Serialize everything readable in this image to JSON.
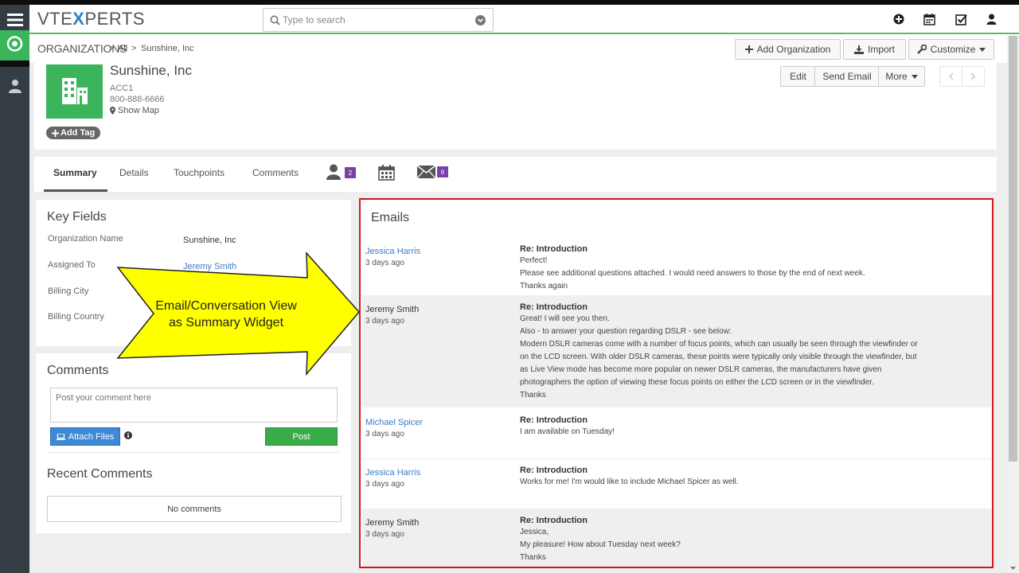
{
  "app": {
    "logo_prefix": "VTE",
    "logo_x": "X",
    "logo_suffix": "PERTS"
  },
  "search": {
    "placeholder": "Type to search"
  },
  "breadcrumb": {
    "module": "ORGANIZATIONS",
    "sep1": ">",
    "all": "All",
    "sep2": ">",
    "record": "Sunshine, Inc"
  },
  "actions": {
    "add_org": "Add Organization",
    "import": "Import",
    "customize": "Customize"
  },
  "record": {
    "name": "Sunshine, Inc",
    "account_no": "ACC1",
    "phone": "800-888-6666",
    "show_map": "Show Map",
    "add_tag": "Add Tag",
    "edit": "Edit",
    "send_email": "Send Email",
    "more": "More"
  },
  "tabs": {
    "summary": "Summary",
    "details": "Details",
    "touchpoints": "Touchpoints",
    "comments": "Comments",
    "contacts_count": "2",
    "emails_count": "6"
  },
  "key_fields": {
    "title": "Key Fields",
    "rows": [
      {
        "label": "Organization Name",
        "value": "Sunshine, Inc"
      },
      {
        "label": "Assigned To",
        "value": "Jeremy Smith"
      },
      {
        "label": "Billing City",
        "value": ""
      },
      {
        "label": "Billing Country",
        "value": ""
      }
    ]
  },
  "comments": {
    "title": "Comments",
    "placeholder": "Post your comment here",
    "attach": "Attach Files",
    "post": "Post"
  },
  "recent_comments": {
    "title": "Recent Comments",
    "empty": "No comments"
  },
  "callout": {
    "line1": "Email/Conversation View",
    "line2": "as Summary Widget"
  },
  "emails": {
    "title": "Emails",
    "items": [
      {
        "from": "Jessica Harris",
        "time": "3 days ago",
        "subject": "Re: Introduction",
        "lines": [
          "Perfect!",
          "Please see additional questions attached. I would need answers to those by the end of next week.",
          "Thanks again"
        ]
      },
      {
        "from": "Jeremy Smith",
        "time": "3 days ago",
        "subject": "Re: Introduction",
        "lines": [
          "Great! I will see you then.",
          "Also - to answer your question regarding DSLR - see below:",
          "Modern DSLR cameras come with a number of focus points, which can usually be seen through the viewfinder or",
          "on the LCD screen. With older DSLR cameras, these points were typically only visible through the viewfinder, but",
          "as Live View mode has become more popular on newer DSLR cameras, the manufacturers have given",
          "photographers the option of viewing these focus points on either the LCD screen or in the viewfinder.",
          "Thanks"
        ]
      },
      {
        "from": "Michael Spicer",
        "time": "3 days ago",
        "subject": "Re: Introduction",
        "lines": [
          "I am available on Tuesday!"
        ]
      },
      {
        "from": "Jessica Harris",
        "time": "3 days ago",
        "subject": "Re: Introduction",
        "lines": [
          "Works for me! I'm would like to include Michael Spicer as well."
        ]
      },
      {
        "from": "Jeremy Smith",
        "time": "3 days ago",
        "subject": "Re: Introduction",
        "lines": [
          "Jessica,",
          "My pleasure! How about Tuesday next week?",
          "Thanks"
        ]
      }
    ]
  },
  "colors": {
    "nav_bg": "#353d44",
    "accent_green": "#3bb55b",
    "link_blue": "#3a7cc0",
    "highlight_red": "#d0161b",
    "badge_purple": "#7b3fa8",
    "callout_yellow": "#ffff00"
  }
}
